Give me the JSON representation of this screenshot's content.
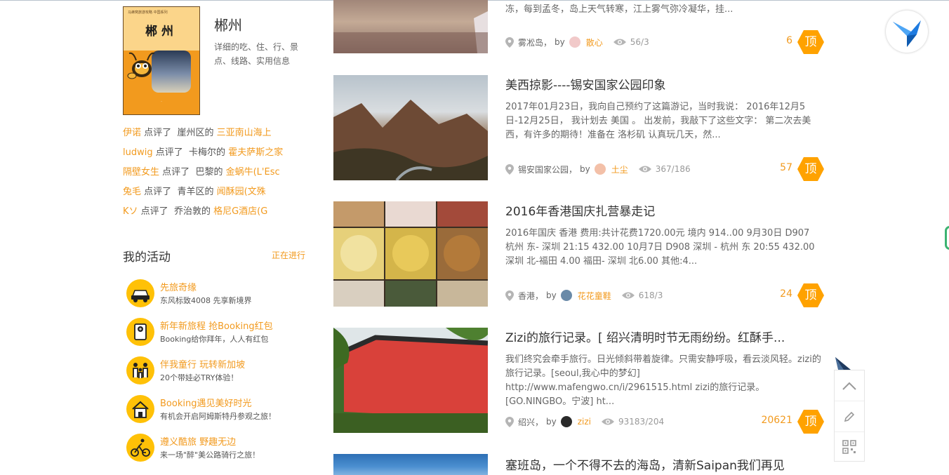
{
  "guide": {
    "cover_series": "马蜂窝旅游攻略 中国系列",
    "cover_title": "郴州",
    "name": "郴州",
    "description": "详细的吃、住、行、景点、线路、实用信息"
  },
  "reviews": [
    {
      "user": "伊诺",
      "action": "点评了",
      "area": "崖州区的",
      "place": "三亚南山海上"
    },
    {
      "user": "ludwig",
      "action": "点评了",
      "area": "卡梅尔的",
      "place": "霍夫萨斯之家"
    },
    {
      "user": "隔壁女生",
      "action": "点评了",
      "area": "巴黎的",
      "place": "金蜗牛(L'Esc"
    },
    {
      "user": "兔毛",
      "action": "点评了",
      "area": "青羊区的",
      "place": "闻酥园(文殊"
    },
    {
      "user": "Kソ",
      "action": "点评了",
      "area": "乔治敦的",
      "place": "格尼G酒店(G"
    }
  ],
  "activities_header": {
    "title": "我的活动",
    "more": "正在进行"
  },
  "activities": [
    {
      "title": "先旅奇缘",
      "subtitle": "东风标致4008 先享新境界",
      "icon": "car-icon"
    },
    {
      "title": "新年新旅程 抢Booking红包",
      "subtitle": "Booking给你拜年，人人有红包",
      "icon": "red-packet-icon"
    },
    {
      "title": "伴我童行 玩转新加坡",
      "subtitle": "20个带娃必TRY体验！",
      "icon": "family-icon"
    },
    {
      "title": "Booking遇见美好时光",
      "subtitle": "有机会开启阿姆斯特丹参观之旅！",
      "icon": "house-icon"
    },
    {
      "title": "遵义酷旅 野趣无边",
      "subtitle": "来一场\"醉\"美公路骑行之旅！",
      "icon": "cyclist-icon"
    }
  ],
  "posts": [
    {
      "title": "",
      "desc": "冻，每到孟冬，岛上天气转寒，江上雾气弥冷凝华，挂...",
      "location": "雾凇岛",
      "by": "by",
      "author": "散心",
      "views": "56/3",
      "votes": "6",
      "ding": "顶"
    },
    {
      "title": "美西掠影----锡安国家公园印象",
      "desc": "2017年01月23日，我向自己预约了这篇游记，当时我说： 2016年12月5日-12月25日， 我计划去 美国 。 出发前，我敲下了这些文字： 第二次去美西，有许多的期待！准备在 洛杉矶 认真玩几天，然...",
      "location": "锡安国家公园",
      "by": "by",
      "author": "土尘",
      "views": "367/186",
      "votes": "57",
      "ding": "顶"
    },
    {
      "title": "2016年香港国庆扎营暴走记",
      "desc": "2016年国庆 香港 费用:共计花费1720.00元 境内 914..00 9月30日 D907 杭州 东- 深圳 21:15 432.00 10月7日 D908 深圳 - 杭州 东 20:55 432.00 深圳 北-福田 4.00 福田- 深圳 北6.00 其他:4...",
      "location": "香港",
      "by": "by",
      "author": "花花童鞋",
      "views": "618/3",
      "votes": "24",
      "ding": "顶"
    },
    {
      "title": "Zizi的旅行记录。[ 绍兴清明时节无雨纷纷。红酥手...",
      "desc": "我们终究会牵手旅行。日光倾斜带着旋律。只需安静呼吸，看云淡风轻。zizi的旅行记录。[seoul,我心中的梦幻] http://www.mafengwo.cn/i/2961515.html zizi的旅行记录。[GO.NINGBO。宁波] ht...",
      "location": "绍兴",
      "by": "by",
      "author": "zizi",
      "views": "93183/204",
      "votes": "20621",
      "ding": "顶"
    },
    {
      "title": "塞班岛，一个不得不去的海岛，清新Saipan我们再见",
      "desc": "",
      "location": "",
      "by": "",
      "author": "",
      "views": "",
      "votes": "",
      "ding": ""
    }
  ],
  "colors": {
    "accent": "#f29a1e",
    "ding_badge": "#ffa200",
    "text": "#333333",
    "muted": "#666666"
  },
  "right_tools": [
    "back-to-top-icon",
    "edit-icon",
    "qrcode-icon"
  ]
}
